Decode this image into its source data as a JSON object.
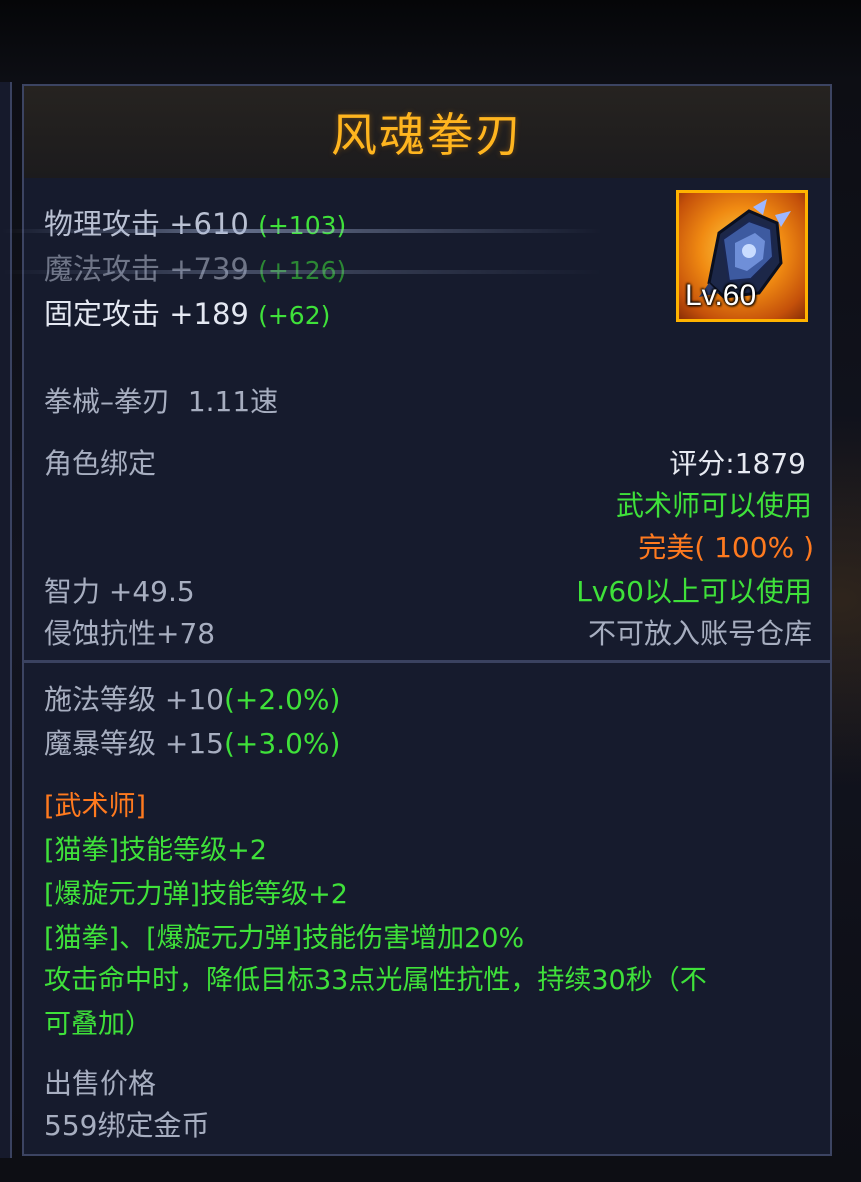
{
  "item": {
    "name": "风魂拳刃",
    "level_badge": "Lv.60"
  },
  "attacks": [
    {
      "name": "物理攻击",
      "value": "+610",
      "bonus": "(+103)"
    },
    {
      "name": "魔法攻击",
      "value": "+739",
      "bonus": "(+126)"
    },
    {
      "name": "固定攻击",
      "value": "+189",
      "bonus": "(+62)"
    }
  ],
  "weapon_type": "拳械–拳刃",
  "attack_speed": "1.11速",
  "binding": "角色绑定",
  "score": "评分:1879",
  "class_requirement": "武术师可以使用",
  "quality": "完美( 100% )",
  "level_requirement": "Lv60以上可以使用",
  "storage_note": "不可放入账号仓库",
  "attributes": [
    {
      "text": "智力 +49.5"
    },
    {
      "text": "侵蚀抗性+78"
    }
  ],
  "ratings": [
    {
      "name": "施法等级 +10",
      "bonus": "(+2.0%)"
    },
    {
      "name": "魔暴等级 +15",
      "bonus": "(+3.0%)"
    }
  ],
  "class_section": {
    "header": "[武术师]",
    "effects": [
      "[猫拳]技能等级+2",
      "[爆旋元力弹]技能等级+2",
      "[猫拳]、[爆旋元力弹]技能伤害增加20%",
      "攻击命中时，降低目标33点光属性抗性，持续30秒（不",
      "可叠加）"
    ]
  },
  "sell": {
    "label": "出售价格",
    "price": "559绑定金币"
  },
  "colors": {
    "title": "#ffb51f",
    "bonus_green": "#3fe13a",
    "quality_orange": "#ff7a1f",
    "panel_bg": "#161b2d",
    "panel_border": "#3c4462"
  }
}
